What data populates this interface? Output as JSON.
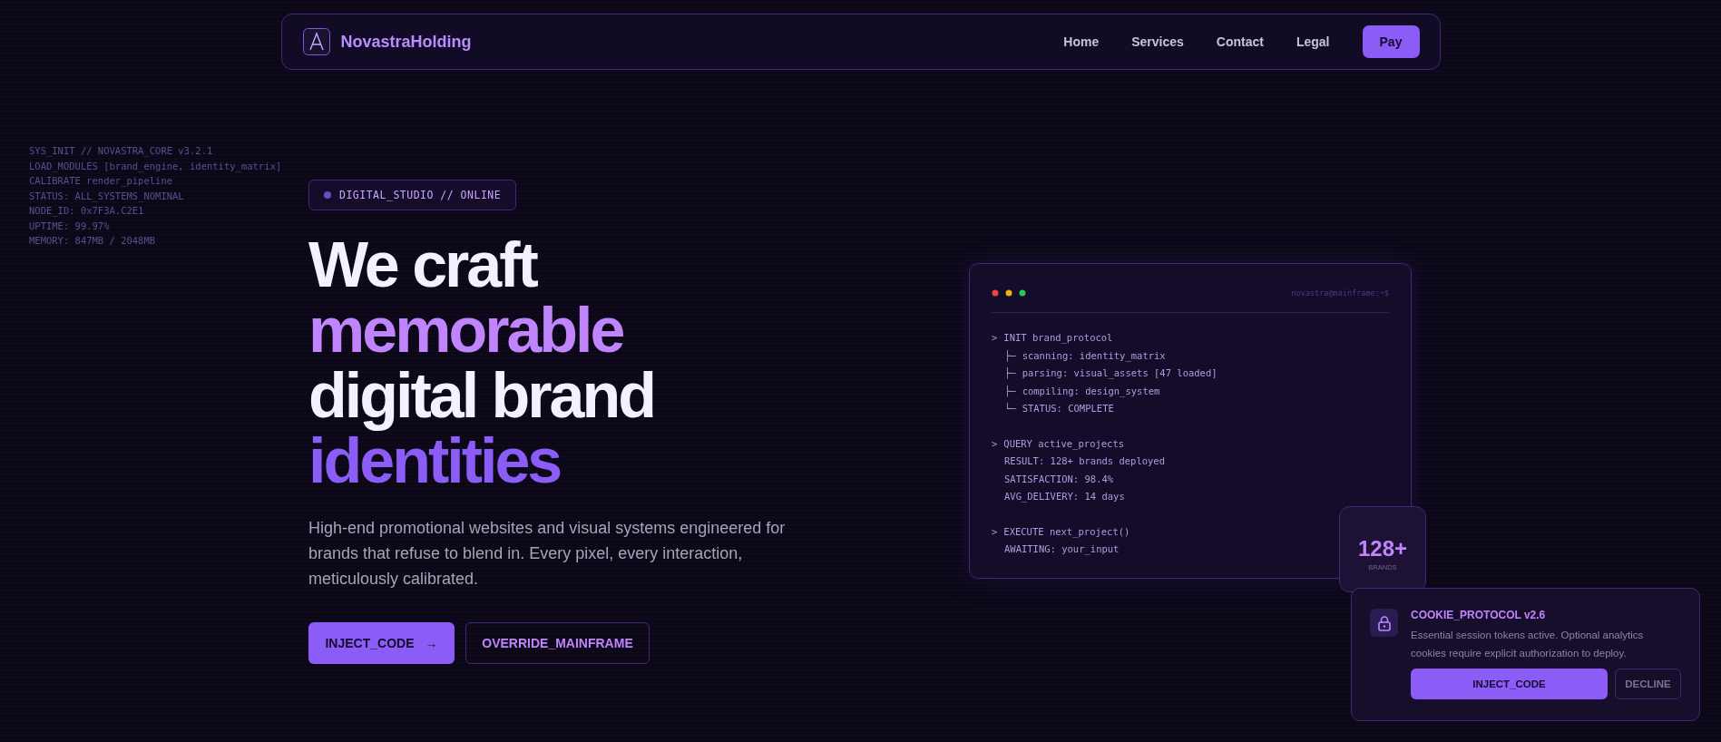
{
  "nav": {
    "brand": "NovastraHolding",
    "links": [
      {
        "label": "Home"
      },
      {
        "label": "Services"
      },
      {
        "label": "Contact"
      },
      {
        "label": "Legal"
      }
    ],
    "cta": "Pay"
  },
  "background_log": [
    "SYS_INIT // NOVASTRA_CORE v3.2.1",
    "LOAD_MODULES [brand_engine, identity_matrix]",
    "CALIBRATE render_pipeline",
    "STATUS: ALL_SYSTEMS_NOMINAL",
    "NODE_ID: 0x7F3A.C2E1",
    "UPTIME: 99.97%",
    "MEMORY: 847MB / 2048MB"
  ],
  "hero": {
    "badge": "DIGITAL_STUDIO // ONLINE",
    "headline": [
      {
        "text": "We craft",
        "kind": "plain"
      },
      {
        "text": "memorable",
        "kind": "accent"
      },
      {
        "text": "digital brand",
        "kind": "plain"
      },
      {
        "text": "identities",
        "kind": "strong"
      }
    ],
    "description": "High-end promotional websites and visual systems engineered for brands that refuse to blend in. Every pixel, every interaction, meticulously calibrated.",
    "buttons": [
      {
        "label": "INJECT_CODE",
        "arrow": "→",
        "kind": "primary"
      },
      {
        "label": "OVERRIDE_MAINFRAME",
        "kind": "outline"
      }
    ]
  },
  "terminal": {
    "prompt": "novastra@mainframe:~$",
    "blocks": [
      [
        {
          "kind": "command",
          "prefix": ">",
          "text": "INIT brand_protocol"
        },
        {
          "kind": "branch",
          "prefix": "├─",
          "text": "scanning: identity_matrix"
        },
        {
          "kind": "branch",
          "prefix": "├─",
          "text": "parsing: visual_assets [47 loaded]"
        },
        {
          "kind": "branch",
          "prefix": "├─",
          "text": "compiling: design_system"
        },
        {
          "kind": "branch",
          "prefix": "└─",
          "text": "STATUS: COMPLETE"
        }
      ],
      [
        {
          "kind": "command",
          "prefix": ">",
          "text": "QUERY active_projects"
        },
        {
          "kind": "output",
          "text": "RESULT: 128+ brands deployed"
        },
        {
          "kind": "output",
          "text": "SATISFACTION: 98.4%"
        },
        {
          "kind": "output",
          "text": "AVG_DELIVERY: 14 days"
        }
      ],
      [
        {
          "kind": "command",
          "prefix": ">",
          "text": "EXECUTE next_project()"
        },
        {
          "kind": "output",
          "text": "AWAITING: your_input"
        }
      ]
    ]
  },
  "stat": {
    "value": "128+",
    "label": "BRANDS"
  },
  "cookie": {
    "title": "COOKIE_PROTOCOL v2.6",
    "text": "Essential session tokens active. Optional analytics cookies require explicit authorization to deploy.",
    "accept": "INJECT_CODE",
    "decline": "DECLINE"
  }
}
